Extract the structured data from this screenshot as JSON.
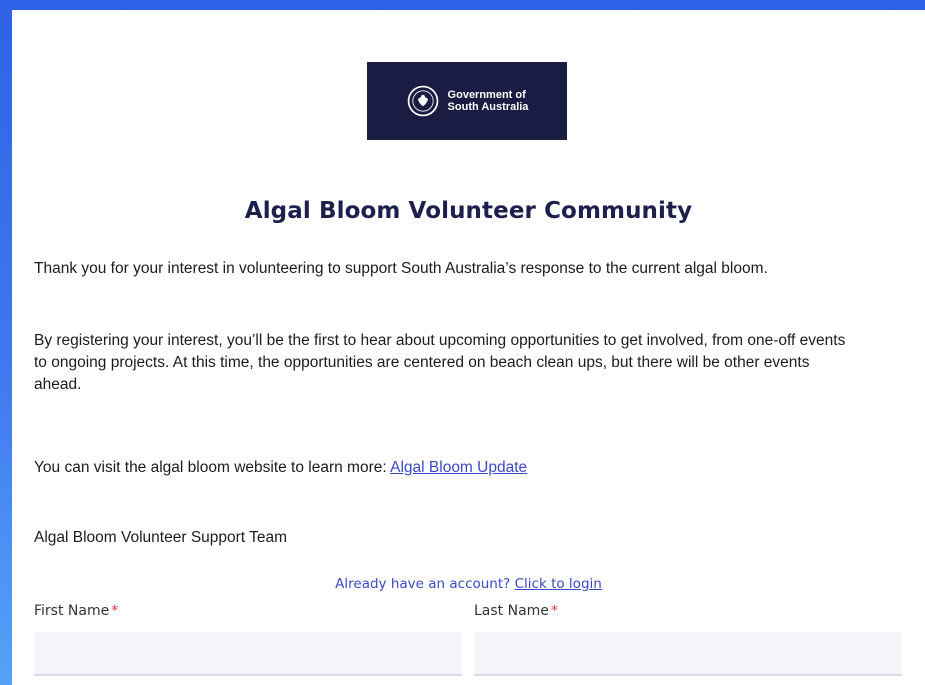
{
  "logo": {
    "text": "Government of\nSouth Australia",
    "icon": "state-badge-icon",
    "background": "#1b1c44"
  },
  "page": {
    "title": "Algal Bloom Volunteer Community",
    "intro": "Thank you for your interest in volunteering to support South Australia’s response to the current algal bloom.",
    "details": "By registering your interest, you’ll be the first to hear about upcoming opportunities to get involved, from one-off events to ongoing projects. At this time, the opportunities are centered on beach clean ups, but there will be other events ahead.",
    "website_prefix": "You can visit the algal bloom website to learn more: ",
    "website_link": "Algal Bloom Update",
    "signoff": "Algal Bloom Volunteer Support Team"
  },
  "login": {
    "prompt": "Already have an account? ",
    "link": "Click to login"
  },
  "form": {
    "first_name_label": "First Name",
    "last_name_label": "Last Name",
    "required_marker": "*",
    "first_name_value": "",
    "last_name_value": ""
  },
  "colors": {
    "accent": "#3b49c8",
    "title": "#1d1f4d",
    "required": "#d83b3b",
    "background_gradient_top": "#2f62e6",
    "background_gradient_bottom": "#56a2f7"
  }
}
